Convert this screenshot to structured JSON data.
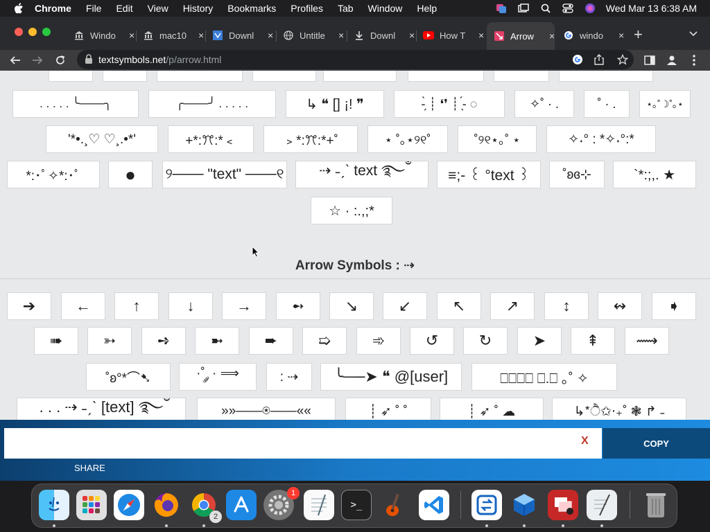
{
  "menubar": {
    "app": "Chrome",
    "items": [
      "File",
      "Edit",
      "View",
      "History",
      "Bookmarks",
      "Profiles",
      "Tab",
      "Window",
      "Help"
    ],
    "clock": "Wed Mar 13  6:38 AM"
  },
  "tabs": [
    {
      "title": "Windo",
      "icon": "bank-icon"
    },
    {
      "title": "mac10",
      "icon": "bank-icon"
    },
    {
      "title": "Downl",
      "icon": "download-site-icon"
    },
    {
      "title": "Untitle",
      "icon": "globe-icon"
    },
    {
      "title": "Downl",
      "icon": "download-icon"
    },
    {
      "title": "How T",
      "icon": "youtube-icon"
    },
    {
      "title": "Arrow",
      "icon": "textsymbols-icon"
    },
    {
      "title": "windo",
      "icon": "google-icon"
    }
  ],
  "active_tab_index": 6,
  "toolbar": {
    "url_domain": "textsymbols.net",
    "url_path": "/p/arrow.html"
  },
  "grid_top": [
    ". . . . .  ╰───╮",
    "╭───╯   . . . . .",
    "↳ ❝ [] ¡! ❞",
    "-̗̀ ┊ ❛❜ ┊ ̖́- ◌",
    "✧˚ · .",
    "˚ · .",
    "⋆｡˚☽˚｡⋆",
    "'*•.¸♡ ♡¸.•*'",
    "+*:ꔫ:*﹤",
    "﹥*:ꔫ:*+˚",
    "⋆ ˚｡⋆୨୧˚",
    "˚୨୧⋆｡˚ ⋆",
    "✧˖° : *✧˖°:*",
    "*:･ﾟ✧*:･ﾟ",
    "●",
    "୨─── \"text\" ───୧",
    "⇢ ˗ˏˋ text ࿐ྂ",
    "≡;- ꒰ °text ꒱",
    "˚ʚɞ⊹",
    "`*:;,. ★",
    "☆ · :.,;*"
  ],
  "arrow_heading": "Arrow Symbols : ⇢",
  "arrows_row1": [
    "➔",
    "←",
    "↑",
    "↓",
    "→",
    "➻",
    "↘",
    "↙",
    "↖",
    "↗",
    "↕",
    "↭",
    "➧"
  ],
  "arrows_row2": [
    "➠",
    "➳",
    "➺",
    "➼",
    "➨",
    "➯",
    "➾",
    "↺",
    "↻",
    "➤",
    "⇞",
    "⟿"
  ],
  "arrows_row3": [
    "˚ʚ°*⌒➷",
    "·˚ ༘ · ⟹",
    ": ⇢",
    "╰──➤ ❝ @[user]",
    "⎕⎕⎕⎕ ⎕.⎕ ｡˚ ✧"
  ],
  "arrows_row4": [
    ". . . ⇢ ˗ˏˋ [text] ࿐ྂ",
    "»»——⍟——««",
    "┊ ➶ ˚ ˚",
    "┊ ➶ ˚ ☁",
    "↳*ੈ✩‧₊˚ ❃ ↱ ˗"
  ],
  "copybar": {
    "input_value": "",
    "clear_label": "X",
    "copy_label": "COPY",
    "share_label": "SHARE"
  },
  "dock": {
    "apps": [
      "Finder",
      "Launchpad",
      "Safari",
      "Firefox",
      "Chrome",
      "App Store",
      "System Preferences",
      "TextEdit",
      "Terminal",
      "GarageBand",
      "VS Code",
      "Migration Assistant",
      "VirtualBox",
      "Photo Booth",
      "Script Editor",
      "Trash"
    ],
    "chrome_badge": "2",
    "settings_badge": "1"
  }
}
